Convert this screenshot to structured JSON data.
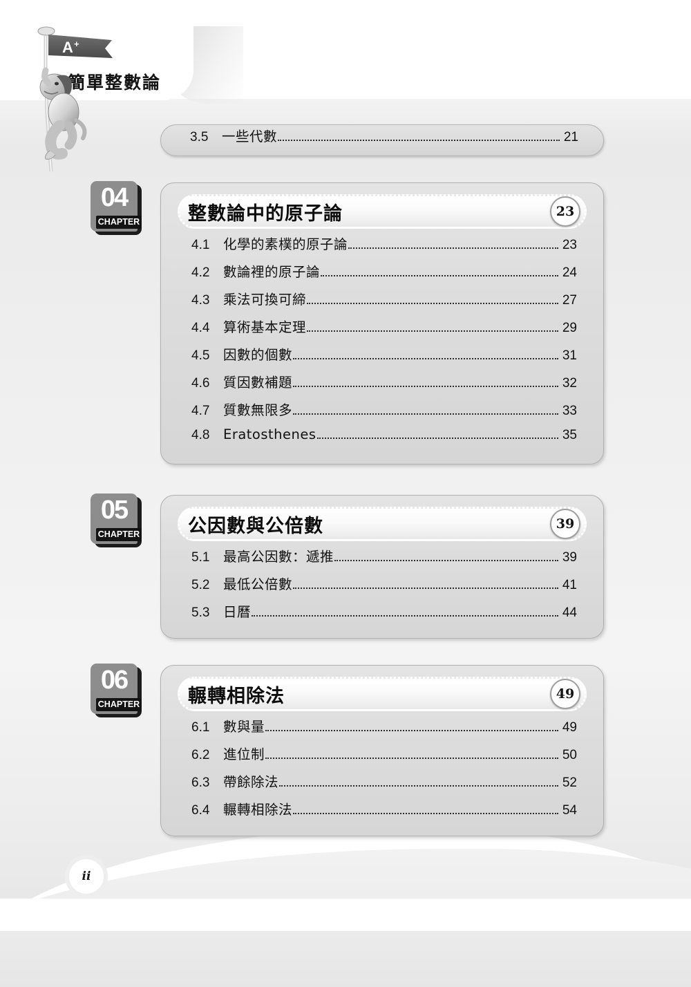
{
  "header": {
    "book_title": "簡單整數論",
    "flag_label": "A+",
    "mascot": "monkey-climbing-rope"
  },
  "lone_entry": {
    "num": "3.5",
    "label": "一些代數",
    "page": "21"
  },
  "chapters": [
    {
      "badge_num": "04",
      "badge_label": "CHAPTER",
      "title": "整數論中的原子論",
      "page": "23",
      "entries": [
        {
          "num": "4.1",
          "label": "化學的素樸的原子論",
          "page": "23"
        },
        {
          "num": "4.2",
          "label": "數論裡的原子論",
          "page": "24"
        },
        {
          "num": "4.3",
          "label": "乘法可換可締",
          "page": "27"
        },
        {
          "num": "4.4",
          "label": "算術基本定理",
          "page": "29"
        },
        {
          "num": "4.5",
          "label": "因數的個數",
          "page": "31"
        },
        {
          "num": "4.6",
          "label": "質因數補題",
          "page": "32"
        },
        {
          "num": "4.7",
          "label": "質數無限多",
          "page": "33"
        },
        {
          "num": "4.8",
          "label": "Eratosthenes",
          "page": "35"
        }
      ]
    },
    {
      "badge_num": "05",
      "badge_label": "CHAPTER",
      "title": "公因數與公倍數",
      "page": "39",
      "entries": [
        {
          "num": "5.1",
          "label": "最高公因數：遞推",
          "page": "39"
        },
        {
          "num": "5.2",
          "label": "最低公倍數",
          "page": "41"
        },
        {
          "num": "5.3",
          "label": "日曆",
          "page": "44"
        }
      ]
    },
    {
      "badge_num": "06",
      "badge_label": "CHAPTER",
      "title": "輾轉相除法",
      "page": "49",
      "entries": [
        {
          "num": "6.1",
          "label": "數與量",
          "page": "49"
        },
        {
          "num": "6.2",
          "label": "進位制",
          "page": "50"
        },
        {
          "num": "6.3",
          "label": "帶餘除法",
          "page": "52"
        },
        {
          "num": "6.4",
          "label": "輾轉相除法",
          "page": "54"
        }
      ]
    }
  ],
  "footer": {
    "page_label": "ii"
  },
  "colors": {
    "box_fill": "#dcdcdc",
    "box_border": "#b0b0b0",
    "badge_body": "#8d8d8d",
    "badge_strip": "#141414",
    "text": "#111111"
  }
}
